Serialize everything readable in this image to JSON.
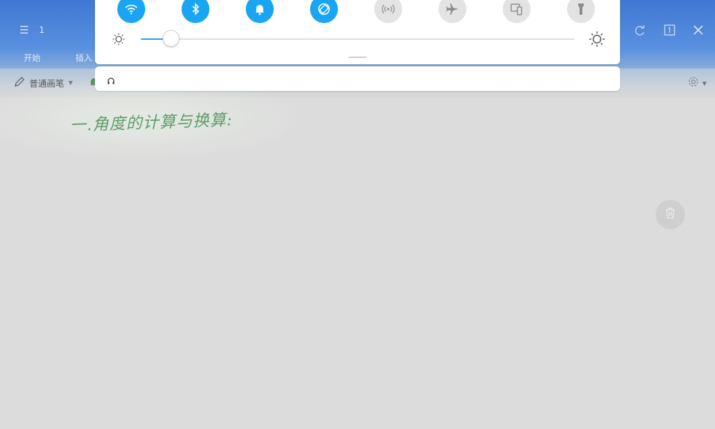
{
  "app": {
    "page_number": "1",
    "tabs": [
      "开始",
      "插入"
    ],
    "pen_tool_label": "普通画笔",
    "canvas_text": "一.角度的计算与换算:"
  },
  "quick_settings": {
    "tiles": [
      {
        "icon": "wifi-icon",
        "state": "on"
      },
      {
        "icon": "bluetooth-icon",
        "state": "on"
      },
      {
        "icon": "bell-icon",
        "state": "on"
      },
      {
        "icon": "auto-rotate-icon",
        "state": "on"
      },
      {
        "icon": "hotspot-icon",
        "state": "off"
      },
      {
        "icon": "airplane-mode-icon",
        "state": "off"
      },
      {
        "icon": "screen-cast-icon",
        "state": "off"
      },
      {
        "icon": "flashlight-icon",
        "state": "off"
      }
    ],
    "brightness_level": 0.07,
    "notification_icon": "headphones-icon"
  },
  "colors": {
    "accent": "#1aa5f2",
    "inactive_tile": "#e3e3e3",
    "title_bar": "#3f78d3",
    "ink": "#5e9d68"
  }
}
